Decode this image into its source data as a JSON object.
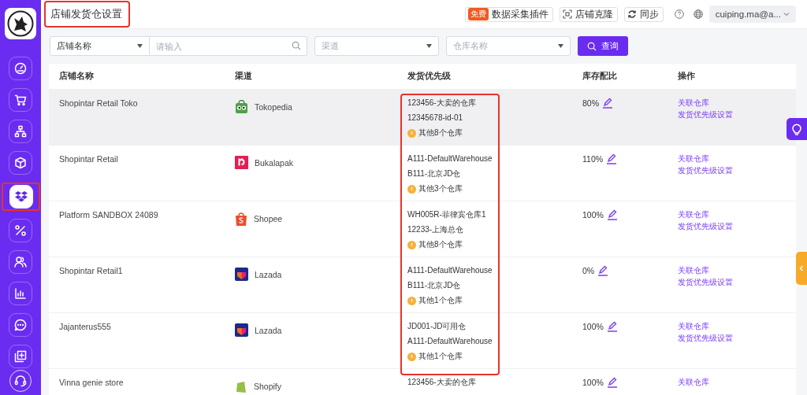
{
  "page_title": "店铺发货仓设置",
  "sidebar": {
    "items": [
      {
        "kind": "gauge",
        "selected": false
      },
      {
        "kind": "cart",
        "selected": false
      },
      {
        "kind": "hierarchy",
        "selected": false
      },
      {
        "kind": "cube",
        "selected": false
      },
      {
        "kind": "boxes",
        "selected": true
      },
      {
        "kind": "percent",
        "selected": false
      },
      {
        "kind": "users",
        "selected": false
      },
      {
        "kind": "chart",
        "selected": false
      },
      {
        "kind": "chat",
        "selected": false
      },
      {
        "kind": "add",
        "selected": false
      }
    ]
  },
  "header": {
    "plugin_badge": "免费",
    "plugin_button": "数据采集插件",
    "clone_button": "店铺克隆",
    "sync_button": "同步",
    "user": "cuiping.ma@a..."
  },
  "filters": {
    "field_select": "店铺名称",
    "search": {
      "placeholder": "请输入"
    },
    "channel": {
      "placeholder": "渠道"
    },
    "warehouse": {
      "placeholder": "仓库名称"
    },
    "query_button": "查询"
  },
  "table": {
    "columns": [
      "店铺名称",
      "渠道",
      "发货优先级",
      "库存配比",
      "操作"
    ],
    "rows": [
      {
        "store": "Shopintar Retail Toko",
        "channel": "Tokopedia",
        "kind": "tokopedia",
        "highlighted": true,
        "warehouses": [
          "123456-大卖的仓库",
          "12345678-id-01"
        ],
        "others": "其他8个仓库",
        "ratio": "80%",
        "actions": [
          "关联仓库",
          "发货优先级设置"
        ]
      },
      {
        "store": "Shopintar Retail",
        "channel": "Bukalapak",
        "kind": "bukalapak",
        "highlighted": false,
        "warehouses": [
          "A111-DefaultWarehouse",
          "B111-北京JD仓"
        ],
        "others": "其他3个仓库",
        "ratio": "110%",
        "actions": [
          "关联仓库",
          "发货优先级设置"
        ]
      },
      {
        "store": "Platform SANDBOX 24089",
        "channel": "Shopee",
        "kind": "shopee",
        "highlighted": false,
        "warehouses": [
          "WH005R-菲律宾仓库1",
          "12233-上海总仓"
        ],
        "others": "其他8个仓库",
        "ratio": "100%",
        "actions": [
          "关联仓库",
          "发货优先级设置"
        ]
      },
      {
        "store": "Shopintar Retail1",
        "channel": "Lazada",
        "kind": "lazada",
        "highlighted": false,
        "warehouses": [
          "A111-DefaultWarehouse",
          "B111-北京JD仓"
        ],
        "others": "其他1个仓库",
        "ratio": "0%",
        "actions": [
          "关联仓库",
          "发货优先级设置"
        ]
      },
      {
        "store": "Jajanterus555",
        "channel": "Lazada",
        "kind": "lazada",
        "highlighted": false,
        "warehouses": [
          "JD001-JD可用仓",
          "A111-DefaultWarehouse"
        ],
        "others": "其他1个仓库",
        "ratio": "100%",
        "actions": [
          "关联仓库",
          "发货优先级设置"
        ]
      },
      {
        "store": "Vinna genie store",
        "channel": "Shopify",
        "kind": "shopify",
        "highlighted": false,
        "warehouses": [
          "123456-大卖的仓库"
        ],
        "ratio": "100%",
        "actions": [
          "关联仓库"
        ]
      }
    ]
  },
  "annotations": {
    "title": true,
    "sidebar_active": true,
    "priority_column": true
  }
}
